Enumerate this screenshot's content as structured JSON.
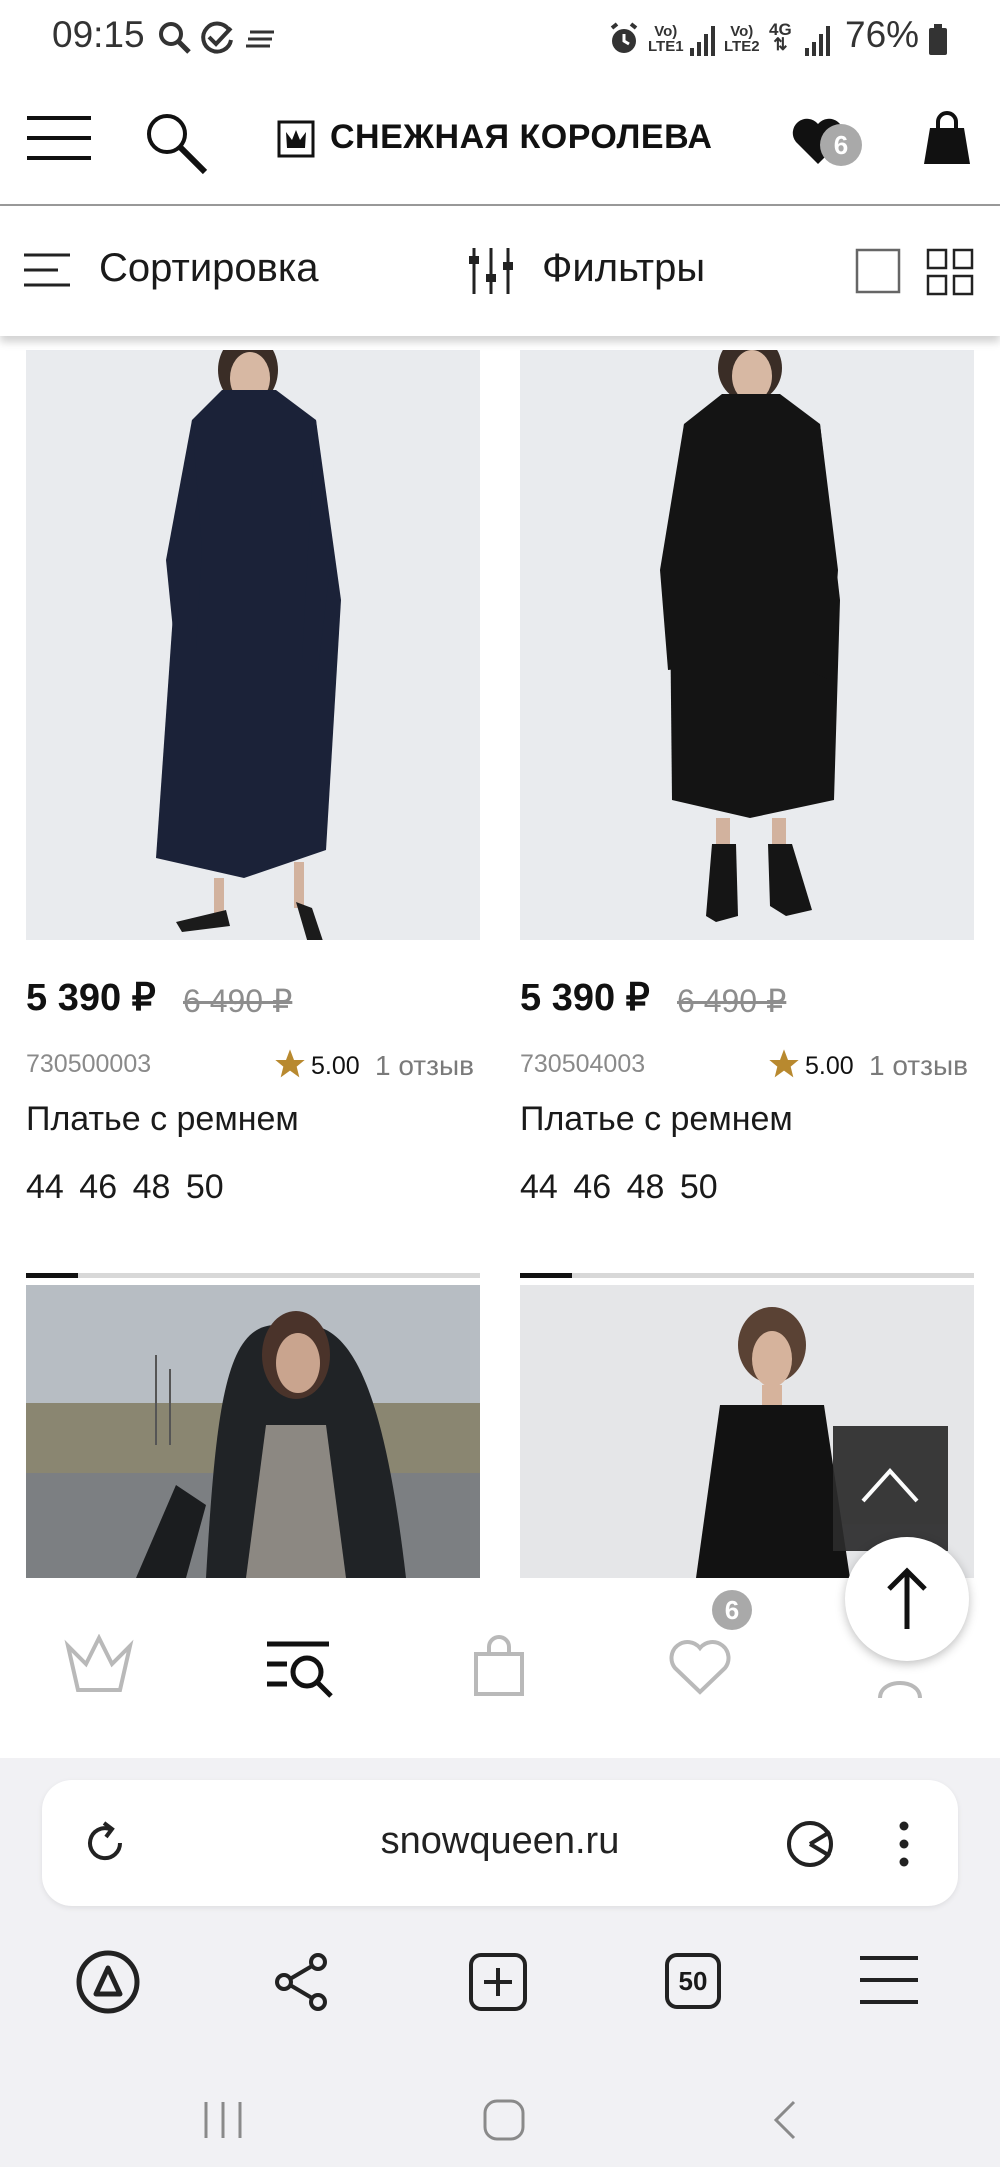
{
  "status_bar": {
    "time": "09:15",
    "battery": "76%",
    "sim1": [
      "Vo)",
      "LTE1"
    ],
    "sim2": [
      "Vo)",
      "LTE2"
    ],
    "network": "4G",
    "icons": [
      "search-icon",
      "check-circle-icon",
      "notes-icon",
      "alarm-icon",
      "signal-icon",
      "battery-icon"
    ]
  },
  "header": {
    "brand": "СНЕЖНАЯ КОРОЛЕВА",
    "wishlist_count": "6",
    "icons": [
      "menu-icon",
      "search-icon",
      "crown-logo-icon",
      "heart-icon",
      "bag-icon"
    ]
  },
  "toolbar": {
    "sort_label": "Сортировка",
    "filters_label": "Фильтры",
    "view_modes": [
      "single-view-icon",
      "grid-view-icon"
    ]
  },
  "products": [
    {
      "price": "5 390 ₽",
      "old_price": "6 490 ₽",
      "sku": "730500003",
      "rating": "5.00",
      "reviews": "1 отзыв",
      "name": "Платье с ремнем",
      "sizes": [
        "44",
        "46",
        "48",
        "50"
      ],
      "dress_color": "#1b2238"
    },
    {
      "price": "5 390 ₽",
      "old_price": "6 490 ₽",
      "sku": "730504003",
      "rating": "5.00",
      "reviews": "1 отзыв",
      "name": "Платье с ремнем",
      "sizes": [
        "44",
        "46",
        "48",
        "50"
      ],
      "dress_color": "#141414"
    }
  ],
  "bottom_nav": {
    "wishlist_count": "6",
    "items": [
      "home-crown-icon",
      "catalog-search-icon",
      "bag-icon",
      "heart-icon",
      "profile-icon"
    ]
  },
  "browser": {
    "url": "snowqueen.ru",
    "tabs_count": "50"
  },
  "colors": {
    "accent_star": "#b8892f",
    "badge": "#a9a9a9",
    "text": "#1a1a1a",
    "muted": "#8a8a8a"
  }
}
